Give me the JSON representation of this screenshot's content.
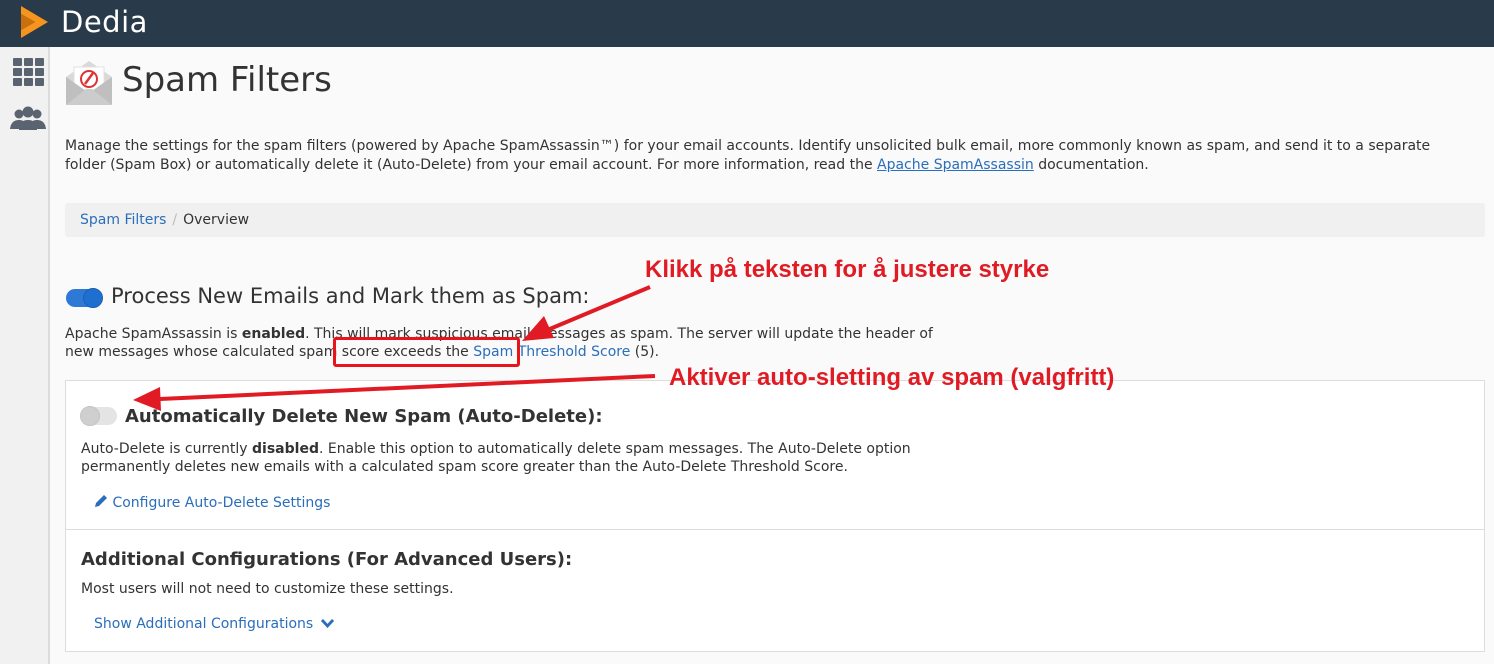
{
  "app": {
    "brand": "Dedia"
  },
  "page": {
    "title": "Spam Filters",
    "intro_part1": "Manage the settings for the spam filters (powered by Apache SpamAssassin™) for your email accounts. Identify unsolicited bulk email, more commonly known as spam, and send it to a separate folder (Spam Box) or automatically delete it (Auto-Delete) from your email account. For more information, read the ",
    "intro_link": "Apache SpamAssassin",
    "intro_part2": " documentation."
  },
  "breadcrumb": {
    "parent": "Spam Filters",
    "separator": "/",
    "current": "Overview"
  },
  "process_section": {
    "title": "Process New Emails and Mark them as Spam:",
    "toggle_state": "on",
    "desc_part1": "Apache SpamAssassin is ",
    "desc_bold": "enabled",
    "desc_part2": ". This will mark suspicious email messages as spam. The server will update the header of new messages whose calculated spam score exceeds the ",
    "threshold_link": "Spam Threshold Score",
    "threshold_value": " (5)."
  },
  "auto_delete_section": {
    "title": "Automatically Delete New Spam (Auto-Delete):",
    "toggle_state": "off",
    "desc_part1": "Auto-Delete is currently ",
    "desc_bold": "disabled",
    "desc_part2": ". Enable this option to automatically delete spam messages. The Auto-Delete option permanently deletes new emails with a calculated spam score greater than the Auto-Delete Threshold Score.",
    "configure_link": "Configure Auto-Delete Settings"
  },
  "additional_section": {
    "title": "Additional Configurations (For Advanced Users):",
    "desc": "Most users will not need to customize these settings.",
    "show_link": "Show Additional Configurations"
  },
  "annotations": {
    "top": "Klikk på teksten for å justere styrke",
    "bottom": "Aktiver auto-sletting av spam (valgfritt)"
  },
  "colors": {
    "topbar": "#293a4a",
    "accent_orange": "#f7941d",
    "link": "#2a6ebb",
    "toggle_on": "#1f6fd1",
    "annotation_red": "#e01b24"
  },
  "icons": [
    "dedia-logo-icon",
    "apps-grid-icon",
    "users-group-icon",
    "spam-filter-envelope-icon",
    "pencil-icon",
    "chevron-down-icon"
  ]
}
